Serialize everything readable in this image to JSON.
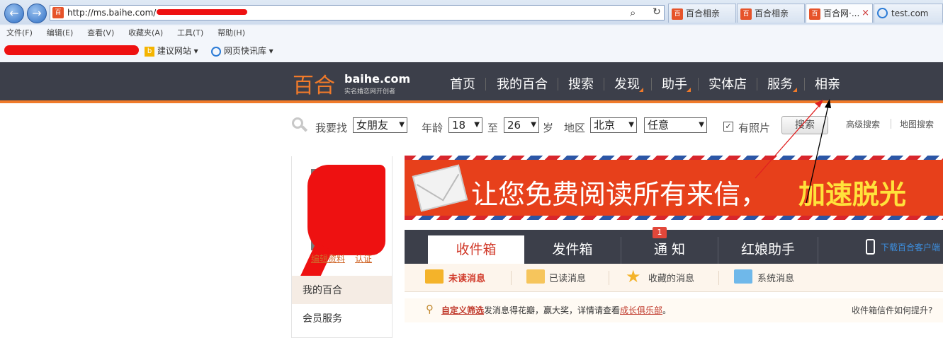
{
  "browser": {
    "address": "http://ms.baihe.com/",
    "tabs": [
      {
        "label": "百合相亲",
        "active": false
      },
      {
        "label": "百合相亲",
        "active": false
      },
      {
        "label": "百合网·...",
        "active": true,
        "close": "×"
      },
      {
        "label": "test.com",
        "active": false
      }
    ],
    "menu": [
      "文件(F)",
      "编辑(E)",
      "查看(V)",
      "收藏夹(A)",
      "工具(T)",
      "帮助(H)"
    ],
    "favorites": [
      {
        "label": "建议网站",
        "icon": "bing-icon"
      },
      {
        "label": "网页快讯库",
        "icon": "ie-icon"
      }
    ],
    "icons": {
      "search": "⌕",
      "refresh": "↻",
      "back": "←",
      "forward": "→"
    }
  },
  "site": {
    "logo_cn": "百合",
    "logo_en": "baihe.com",
    "logo_tagline": "实名婚恋网开创者",
    "nav": [
      "首页",
      "我的百合",
      "搜索",
      "发现",
      "助手",
      "实体店",
      "服务",
      "相亲"
    ],
    "accent": "#f07a2a",
    "header_bg": "#3c3f4a"
  },
  "search": {
    "find_label": "我要找",
    "find_value": "女朋友",
    "age_label": "年龄",
    "age_from": "18",
    "to_label": "至",
    "age_to": "26",
    "age_unit": "岁",
    "region_label": "地区",
    "region_value": "北京",
    "region_sub": "任意",
    "photo_label": "有照片",
    "photo_checked": true,
    "button": "搜索",
    "advanced": "高级搜索",
    "map": "地图搜索"
  },
  "left": {
    "profile_edit": "编辑资料",
    "verify": "认证",
    "items": [
      "我的百合",
      "会员服务"
    ]
  },
  "banner": {
    "text_normal": "让您免费阅读所有来信，",
    "text_bold": "加速脱光"
  },
  "mail": {
    "tabs": [
      "收件箱",
      "发件箱",
      "通 知",
      "红娘助手"
    ],
    "notice_badge": "1",
    "download": "下载百合客户端",
    "sub": [
      "未读消息",
      "已读消息",
      "收藏的消息",
      "系统消息"
    ],
    "tip_link": "自定义筛选",
    "tip_text": "发消息得花瓣，赢大奖，详情请查看",
    "tip_link2": "成长俱乐部",
    "tip_end": "。",
    "tip_right": "收件箱信件如何提升?"
  }
}
